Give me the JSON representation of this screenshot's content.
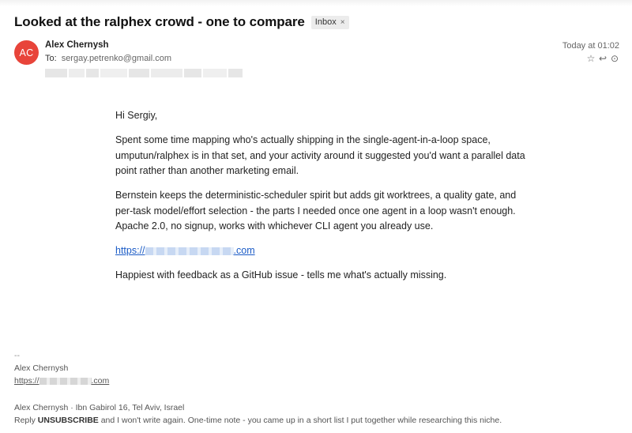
{
  "email": {
    "subject": "Looked at the ralphex crowd - one to compare",
    "label": "Inbox",
    "label_remove": "×",
    "sender": {
      "initials": "AC",
      "avatar_color": "#e8443a",
      "name": "Alex Chernysh",
      "to_label": "To:",
      "to_address": "sergay.petrenko@gmail.com"
    },
    "date": "Today at 01:02",
    "actions": [
      {
        "name": "star-icon",
        "glyph": "☆"
      },
      {
        "name": "reply-icon",
        "glyph": "↩"
      },
      {
        "name": "more-icon",
        "glyph": "⊙"
      }
    ],
    "body": {
      "greeting": "Hi Sergiy,",
      "p1": "Spent some time mapping who's actually shipping in the single-agent-in-a-loop space, umputun/ralphex is in that set, and your activity around it suggested you'd want a parallel data point rather than another marketing email.",
      "p2": "Bernstein keeps the deterministic-scheduler spirit but adds git worktrees, a quality gate, and per-task model/effort selection - the parts I needed once one agent in a loop wasn't enough. Apache 2.0, no signup, works with whichever CLI agent you already use.",
      "link_prefix": "https://",
      "link_suffix": ".com",
      "closing": "Happiest with feedback as a GitHub issue - tells me what's actually missing."
    },
    "signature": {
      "dashes": "--",
      "name": "Alex Chernysh",
      "link_prefix": "https://",
      "link_suffix": ".com"
    },
    "footer": {
      "address": "Alex Chernysh · Ibn Gabirol 16, Tel Aviv, Israel",
      "reply_prefix": "Reply",
      "unsubscribe": "UNSUBSCRIBE",
      "reply_suffix": "and I won't write again. One-time note - you came up in a short list I put together while researching this niche."
    }
  }
}
